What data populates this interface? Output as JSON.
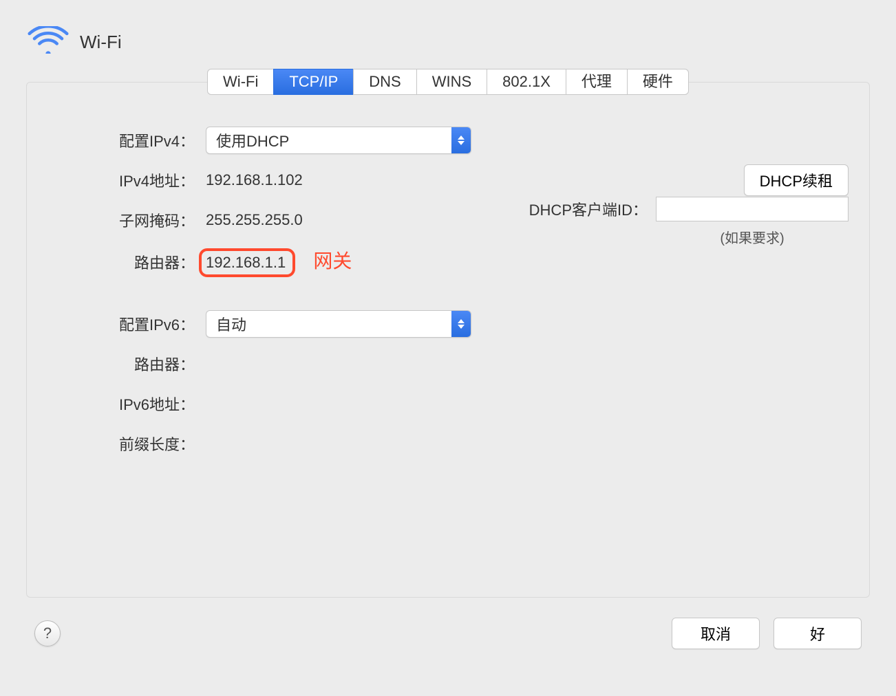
{
  "header": {
    "title": "Wi-Fi"
  },
  "tabs": [
    {
      "label": "Wi-Fi",
      "active": false
    },
    {
      "label": "TCP/IP",
      "active": true
    },
    {
      "label": "DNS",
      "active": false
    },
    {
      "label": "WINS",
      "active": false
    },
    {
      "label": "802.1X",
      "active": false
    },
    {
      "label": "代理",
      "active": false
    },
    {
      "label": "硬件",
      "active": false
    }
  ],
  "ipv4": {
    "config_label": "配置IPv4：",
    "config_value": "使用DHCP",
    "address_label": "IPv4地址：",
    "address_value": "192.168.1.102",
    "subnet_label": "子网掩码：",
    "subnet_value": "255.255.255.0",
    "router_label": "路由器：",
    "router_value": "192.168.1.1",
    "dhcp_renew_btn": "DHCP续租",
    "dhcp_client_label": "DHCP客户端ID：",
    "dhcp_client_value": "",
    "dhcp_client_hint": "(如果要求)"
  },
  "annotation": {
    "router_note": "网关"
  },
  "ipv6": {
    "config_label": "配置IPv6：",
    "config_value": "自动",
    "router_label": "路由器：",
    "router_value": "",
    "address_label": "IPv6地址：",
    "address_value": "",
    "prefix_label": "前缀长度：",
    "prefix_value": ""
  },
  "footer": {
    "help": "?",
    "cancel": "取消",
    "ok": "好"
  }
}
